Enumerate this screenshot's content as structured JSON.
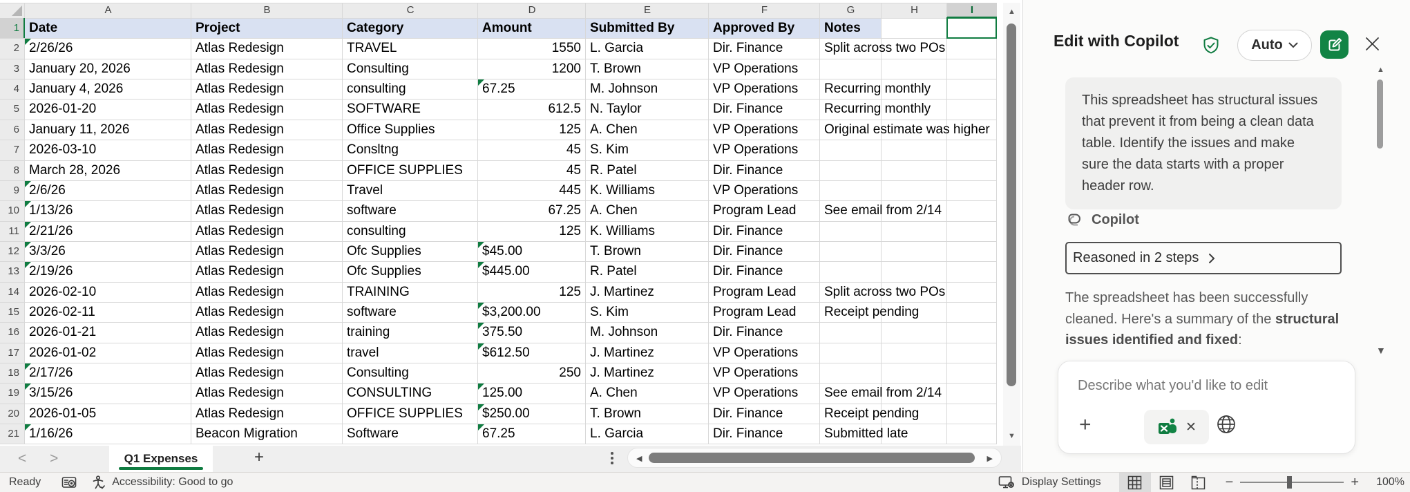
{
  "sheet": {
    "column_letters": [
      "A",
      "B",
      "C",
      "D",
      "E",
      "F",
      "G",
      "H",
      "I"
    ],
    "selected_column": "I",
    "header_row": {
      "num": "1",
      "cells": [
        "Date",
        "Project",
        "Category",
        "Amount",
        "Submitted By",
        "Approved By",
        "Notes"
      ]
    },
    "rows": [
      {
        "num": "2",
        "date": "2/26/26",
        "date_flag": true,
        "project": "Atlas Redesign",
        "category": "TRAVEL",
        "amount": "1550",
        "amount_flag": false,
        "submitted_by": "L. Garcia",
        "approved_by": "Dir. Finance",
        "notes": "Split across two POs"
      },
      {
        "num": "3",
        "date": "January 20, 2026",
        "date_flag": false,
        "project": "Atlas Redesign",
        "category": "Consulting",
        "amount": "1200",
        "amount_flag": false,
        "submitted_by": "T. Brown",
        "approved_by": "VP Operations",
        "notes": ""
      },
      {
        "num": "4",
        "date": "January 4, 2026",
        "date_flag": false,
        "project": "Atlas Redesign",
        "category": "consulting",
        "amount": "67.25",
        "amount_flag": true,
        "submitted_by": "M. Johnson",
        "approved_by": "VP Operations",
        "notes": "Recurring monthly"
      },
      {
        "num": "5",
        "date": "2026-01-20",
        "date_flag": false,
        "project": "Atlas Redesign",
        "category": "SOFTWARE",
        "amount": "612.5",
        "amount_flag": false,
        "submitted_by": "N. Taylor",
        "approved_by": "Dir. Finance",
        "notes": "Recurring monthly"
      },
      {
        "num": "6",
        "date": "January 11, 2026",
        "date_flag": false,
        "project": "Atlas Redesign",
        "category": "Office Supplies",
        "amount": "125",
        "amount_flag": false,
        "submitted_by": "A. Chen",
        "approved_by": "VP Operations",
        "notes": "Original estimate was higher"
      },
      {
        "num": "7",
        "date": "2026-03-10",
        "date_flag": false,
        "project": "Atlas Redesign",
        "category": "Consltng",
        "amount": "45",
        "amount_flag": false,
        "submitted_by": "S. Kim",
        "approved_by": "VP Operations",
        "notes": ""
      },
      {
        "num": "8",
        "date": "March 28, 2026",
        "date_flag": false,
        "project": "Atlas Redesign",
        "category": "OFFICE SUPPLIES",
        "amount": "45",
        "amount_flag": false,
        "submitted_by": "R. Patel",
        "approved_by": "Dir. Finance",
        "notes": ""
      },
      {
        "num": "9",
        "date": "2/6/26",
        "date_flag": true,
        "project": "Atlas Redesign",
        "category": "Travel",
        "amount": "445",
        "amount_flag": false,
        "submitted_by": "K. Williams",
        "approved_by": "VP Operations",
        "notes": ""
      },
      {
        "num": "10",
        "date": "1/13/26",
        "date_flag": true,
        "project": "Atlas Redesign",
        "category": "software",
        "amount": "67.25",
        "amount_flag": false,
        "submitted_by": "A. Chen",
        "approved_by": "Program Lead",
        "notes": "See email from 2/14"
      },
      {
        "num": "11",
        "date": "2/21/26",
        "date_flag": true,
        "project": "Atlas Redesign",
        "category": "consulting",
        "amount": "125",
        "amount_flag": false,
        "submitted_by": "K. Williams",
        "approved_by": "Dir. Finance",
        "notes": ""
      },
      {
        "num": "12",
        "date": "3/3/26",
        "date_flag": true,
        "project": "Atlas Redesign",
        "category": "Ofc Supplies",
        "amount": "$45.00",
        "amount_flag": true,
        "submitted_by": "T. Brown",
        "approved_by": "Dir. Finance",
        "notes": ""
      },
      {
        "num": "13",
        "date": "2/19/26",
        "date_flag": true,
        "project": "Atlas Redesign",
        "category": "Ofc Supplies",
        "amount": "$445.00",
        "amount_flag": true,
        "submitted_by": "R. Patel",
        "approved_by": "Dir. Finance",
        "notes": ""
      },
      {
        "num": "14",
        "date": "2026-02-10",
        "date_flag": false,
        "project": "Atlas Redesign",
        "category": "TRAINING",
        "amount": "125",
        "amount_flag": false,
        "submitted_by": "J. Martinez",
        "approved_by": "Program Lead",
        "notes": "Split across two POs"
      },
      {
        "num": "15",
        "date": "2026-02-11",
        "date_flag": false,
        "project": "Atlas Redesign",
        "category": "software",
        "amount": "$3,200.00",
        "amount_flag": true,
        "submitted_by": "S. Kim",
        "approved_by": "Program Lead",
        "notes": "Receipt pending"
      },
      {
        "num": "16",
        "date": "2026-01-21",
        "date_flag": false,
        "project": "Atlas Redesign",
        "category": "training",
        "amount": "375.50",
        "amount_flag": true,
        "submitted_by": "M. Johnson",
        "approved_by": "Dir. Finance",
        "notes": ""
      },
      {
        "num": "17",
        "date": "2026-01-02",
        "date_flag": false,
        "project": "Atlas Redesign",
        "category": "travel",
        "amount": "$612.50",
        "amount_flag": true,
        "submitted_by": "J. Martinez",
        "approved_by": "VP Operations",
        "notes": ""
      },
      {
        "num": "18",
        "date": "2/17/26",
        "date_flag": true,
        "project": "Atlas Redesign",
        "category": "Consulting",
        "amount": "250",
        "amount_flag": false,
        "submitted_by": "J. Martinez",
        "approved_by": "VP Operations",
        "notes": ""
      },
      {
        "num": "19",
        "date": "3/15/26",
        "date_flag": true,
        "project": "Atlas Redesign",
        "category": "CONSULTING",
        "amount": "125.00",
        "amount_flag": true,
        "submitted_by": "A. Chen",
        "approved_by": "VP Operations",
        "notes": "See email from 2/14"
      },
      {
        "num": "20",
        "date": "2026-01-05",
        "date_flag": false,
        "project": "Atlas Redesign",
        "category": "OFFICE SUPPLIES",
        "amount": "$250.00",
        "amount_flag": true,
        "submitted_by": "T. Brown",
        "approved_by": "Dir. Finance",
        "notes": "Receipt pending"
      },
      {
        "num": "21",
        "date": "1/16/26",
        "date_flag": true,
        "project": "Beacon Migration",
        "category": "Software",
        "amount": "67.25",
        "amount_flag": true,
        "submitted_by": "L. Garcia",
        "approved_by": "Dir. Finance",
        "notes": "Submitted late"
      }
    ]
  },
  "tabs": {
    "sheet_name": "Q1 Expenses",
    "add_label": "+",
    "prev_label": "<",
    "next_label": ">"
  },
  "status_bar": {
    "ready": "Ready",
    "accessibility": "Accessibility: Good to go",
    "display_settings": "Display Settings",
    "zoom_level": "100%",
    "zoom_minus": "−",
    "zoom_plus": "+"
  },
  "copilot": {
    "title": "Edit with Copilot",
    "mode_label": "Auto",
    "user_message": "This spreadsheet has structural issues that prevent it from being a clean data table. Identify the issues and make sure the data starts with a proper header row.",
    "agent_name": "Copilot",
    "reasoned_label": "Reasoned in 2 steps",
    "response_prefix": "The spreadsheet has been successfully cleaned. Here's a summary of the ",
    "response_bold": "structural issues identified and fixed",
    "response_suffix": ":",
    "input_placeholder": "Describe what you'd like to edit"
  },
  "colors": {
    "accent_green": "#107C41",
    "header_fill": "#D9E1F2",
    "selected_header_gray": "#d2d2d2",
    "error_flag_green": "#107C41"
  }
}
